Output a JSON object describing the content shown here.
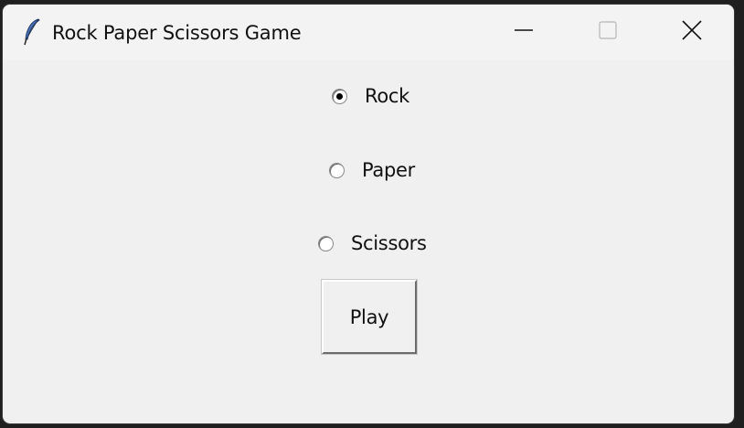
{
  "window": {
    "title": "Rock Paper Scissors Game",
    "icon": "feather-icon",
    "controls": [
      "minimize-icon",
      "maximize-icon",
      "close-icon"
    ]
  },
  "choices": [
    {
      "label": "Rock",
      "selected": true
    },
    {
      "label": "Paper",
      "selected": false
    },
    {
      "label": "Scissors",
      "selected": false
    }
  ],
  "play_label": "Play"
}
